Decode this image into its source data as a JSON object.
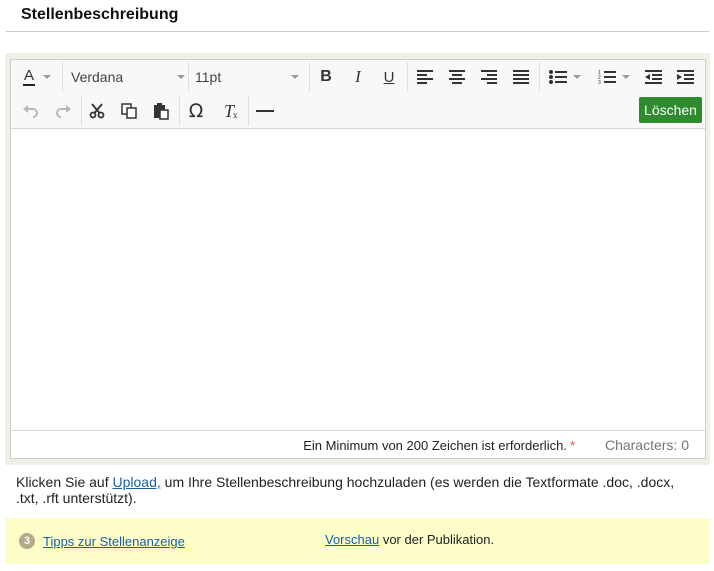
{
  "section": {
    "title": "Stellenbeschreibung"
  },
  "toolbar": {
    "font_family": "Verdana",
    "font_size": "11pt",
    "delete_label": "Löschen",
    "icons": [
      "text-color-icon",
      "bold-icon",
      "italic-icon",
      "underline-icon",
      "align-left-icon",
      "align-center-icon",
      "align-right-icon",
      "align-justify-icon",
      "bullet-list-icon",
      "numbered-list-icon",
      "outdent-icon",
      "indent-icon",
      "undo-icon",
      "redo-icon",
      "cut-icon",
      "copy-icon",
      "paste-icon",
      "special-char-icon",
      "clear-format-icon",
      "horizontal-rule-icon"
    ]
  },
  "status": {
    "min_note": "Ein Minimum von 200 Zeichen ist erforderlich.",
    "required_mark": "*",
    "characters": "Characters: 0"
  },
  "upload": {
    "prefix": "Klicken Sie auf ",
    "link": "Upload,",
    "suffix": " um Ihre Stellenbeschreibung hochzuladen (es werden die Textformate .doc, .docx, .txt, .rft unterstützt)."
  },
  "tips": {
    "badge": "3",
    "link": "Tipps zur Stellenanzeige",
    "preview_link": "Vorschau",
    "preview_suffix": " vor der Publikation."
  },
  "colors": {
    "accent_green": "#2e8b2e",
    "link_blue": "#1a5fa8",
    "tips_bg": "#fdfdc8",
    "frame_bg": "#eef0e6"
  }
}
